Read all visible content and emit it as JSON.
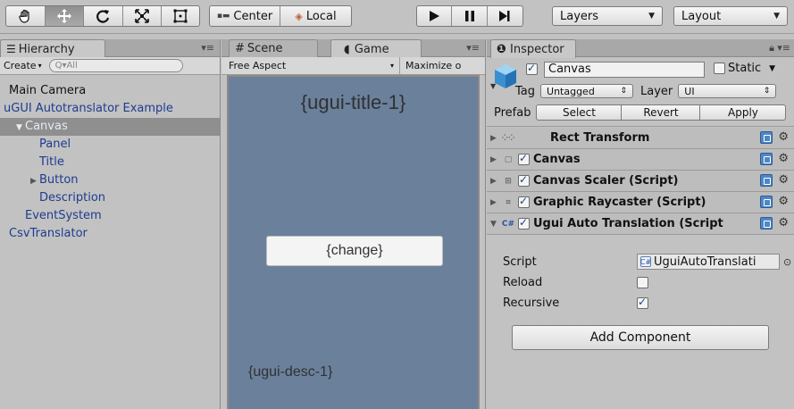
{
  "toolbar": {
    "tools": [
      "hand-tool",
      "move-tool",
      "rotate-tool",
      "scale-tool",
      "rect-tool"
    ],
    "active_tool": "move-tool",
    "pivot_label": "Center",
    "space_label": "Local",
    "layers_label": "Layers",
    "layout_label": "Layout"
  },
  "hierarchy": {
    "tab_label": "Hierarchy",
    "create_label": "Create",
    "search_placeholder": "Q▾All",
    "items": [
      {
        "label": "Main Camera",
        "depth": 0,
        "prefab": false,
        "selected": false,
        "fold": ""
      },
      {
        "label": "uGUI Autotranslator Example",
        "depth": 0,
        "prefab": true,
        "selected": false,
        "fold": ""
      },
      {
        "label": "Canvas",
        "depth": 1,
        "prefab": true,
        "selected": true,
        "fold": "▼"
      },
      {
        "label": "Panel",
        "depth": 2,
        "prefab": true,
        "selected": false,
        "fold": ""
      },
      {
        "label": "Title",
        "depth": 2,
        "prefab": true,
        "selected": false,
        "fold": ""
      },
      {
        "label": "Button",
        "depth": 2,
        "prefab": true,
        "selected": false,
        "fold": "▶"
      },
      {
        "label": "Description",
        "depth": 2,
        "prefab": true,
        "selected": false,
        "fold": ""
      },
      {
        "label": "EventSystem",
        "depth": 1,
        "prefab": true,
        "selected": false,
        "fold": ""
      },
      {
        "label": "CsvTranslator",
        "depth": 0,
        "prefab": true,
        "selected": false,
        "fold": ""
      }
    ]
  },
  "views": {
    "scene_tab": "Scene",
    "game_tab": "Game",
    "aspect_label": "Free Aspect",
    "maximize_label": "Maximize o",
    "game": {
      "title_text": "{ugui-title-1}",
      "button_text": "{change}",
      "desc_text": "{ugui-desc-1}"
    }
  },
  "inspector": {
    "tab_label": "Inspector",
    "object_name": "Canvas",
    "active": true,
    "static_label": "Static",
    "static_checked": false,
    "tag_label": "Tag",
    "tag_value": "Untagged",
    "layer_label": "Layer",
    "layer_value": "UI",
    "prefab_label": "Prefab",
    "prefab_select": "Select",
    "prefab_revert": "Revert",
    "prefab_apply": "Apply",
    "components": [
      {
        "name": "Rect Transform",
        "has_checkbox": false,
        "expanded": false
      },
      {
        "name": "Canvas",
        "has_checkbox": true,
        "expanded": false
      },
      {
        "name": "Canvas Scaler (Script)",
        "has_checkbox": true,
        "expanded": false
      },
      {
        "name": "Graphic Raycaster (Script)",
        "has_checkbox": true,
        "expanded": false
      },
      {
        "name": "Ugui Auto Translation (Script",
        "has_checkbox": true,
        "expanded": true
      }
    ],
    "script_label": "Script",
    "script_value": "UguiAutoTranslati",
    "reload_label": "Reload",
    "reload_checked": false,
    "recursive_label": "Recursive",
    "recursive_checked": true,
    "add_component_label": "Add Component"
  },
  "colors": {
    "game_bg": "#6b809b",
    "selection": "#8f8f8f",
    "prefab_text": "#1d3c90"
  }
}
